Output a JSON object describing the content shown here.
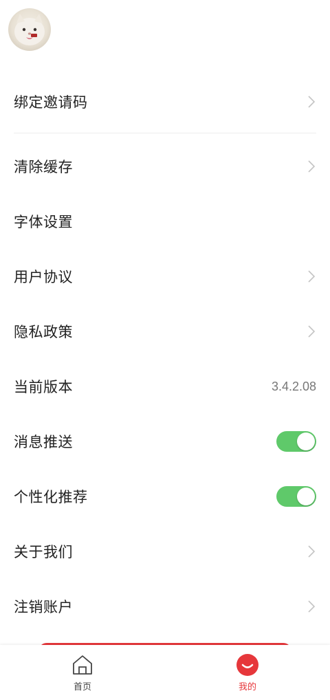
{
  "profile": {
    "avatar_icon": "cat-avatar-icon"
  },
  "settings": [
    {
      "label": "绑定邀请码",
      "kind": "chevron"
    },
    {
      "label": "清除缓存",
      "kind": "chevron"
    },
    {
      "label": "字体设置",
      "kind": "none"
    },
    {
      "label": "用户协议",
      "kind": "chevron"
    },
    {
      "label": "隐私政策",
      "kind": "chevron"
    },
    {
      "label": "当前版本",
      "kind": "value",
      "value": "3.4.2.08"
    },
    {
      "label": "消息推送",
      "kind": "toggle",
      "on": true
    },
    {
      "label": "个性化推荐",
      "kind": "toggle",
      "on": true
    },
    {
      "label": "关于我们",
      "kind": "chevron"
    },
    {
      "label": "注销账户",
      "kind": "chevron"
    }
  ],
  "tabbar": {
    "home_label": "首页",
    "mine_label": "我的",
    "active": "mine",
    "accent_color": "#e6373b",
    "toggle_color": "#5fc96a"
  }
}
